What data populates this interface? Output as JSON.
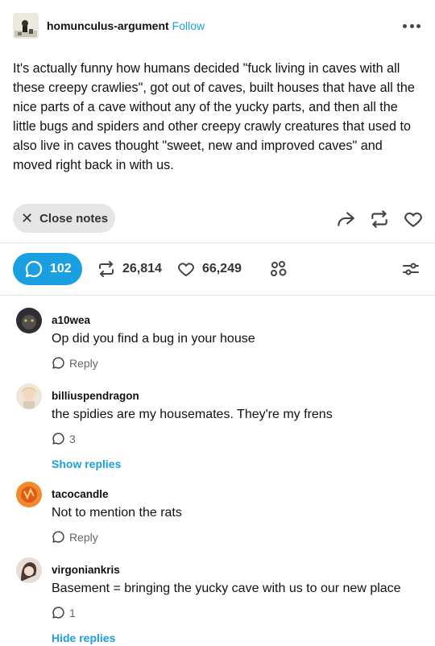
{
  "post": {
    "blog_name": "homunculus-argument",
    "follow_label": "Follow",
    "body": "It's actually funny how humans decided \"fuck living in caves with all these creepy crawlies\", got out of caves, built houses that have all the nice parts of a cave without any of the yucky parts, and then all the little bugs and spiders and other creepy crawly creatures that used to also live in caves thought \"sweet, new and improved caves\" and moved right back in with us.",
    "close_notes_label": "Close notes"
  },
  "tabs": {
    "replies_count": "102",
    "reblogs_count": "26,814",
    "likes_count": "66,249"
  },
  "icons": {
    "more": "more-horizontal-icon",
    "close": "close-icon",
    "share": "share-icon",
    "reblog": "reblog-icon",
    "like": "heart-icon",
    "replies": "chat-bubble-icon",
    "community": "community-icon",
    "filter": "filter-sliders-icon"
  },
  "colors": {
    "accent": "#1a9fe0",
    "pill_bg": "#e6e6e6"
  },
  "notes": [
    {
      "username": "a10wea",
      "text": "Op did you find a bug in your house",
      "meta": "Reply",
      "toggle": ""
    },
    {
      "username": "billiuspendragon",
      "text": "the spidies are my housemates. They're my frens",
      "meta": "3",
      "toggle": "Show replies"
    },
    {
      "username": "tacocandle",
      "text": "Not to mention the rats",
      "meta": "Reply",
      "toggle": ""
    },
    {
      "username": "virgoniankris",
      "text": "Basement = bringing the yucky cave with us to our new place",
      "meta": "1",
      "toggle": "Hide replies"
    }
  ]
}
